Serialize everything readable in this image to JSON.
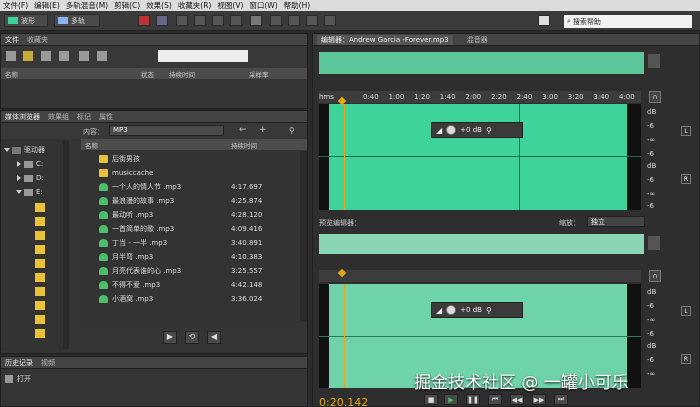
{
  "menu": [
    "文件(F)",
    "编辑(E)",
    "多轨混音(M)",
    "剪辑(C)",
    "效果(S)",
    "收藏夹(R)",
    "视图(V)",
    "窗口(W)",
    "帮助(H)"
  ],
  "toolbar": {
    "waveform_label": "波形",
    "multitrack_label": "多轨",
    "search_placeholder": "搜索帮助"
  },
  "files_panel": {
    "tabs": [
      "文件",
      "收藏夹"
    ],
    "columns": [
      "名称",
      "状态",
      "持续时间",
      "采样率"
    ]
  },
  "media_browser": {
    "tabs": [
      "媒体浏览器",
      "效果组",
      "标记",
      "属性"
    ],
    "content_label": "内容：",
    "content_value": "MP3",
    "drive_items": [
      "驱动器",
      "C:",
      "D:",
      "E:"
    ],
    "columns": [
      "名称",
      "持续时间"
    ],
    "rows": [
      {
        "name": "后街男孩",
        "duration": "",
        "type": "folder"
      },
      {
        "name": "musiccache",
        "duration": "",
        "type": "folder"
      },
      {
        "name": "一个人的情人节 .mp3",
        "duration": "4:17.697",
        "type": "mp3"
      },
      {
        "name": "最浪漫的故事 .mp3",
        "duration": "4:25.874",
        "type": "mp3"
      },
      {
        "name": "最动听 .mp3",
        "duration": "4:28.120",
        "type": "mp3"
      },
      {
        "name": "一首简单的歌 .mp3",
        "duration": "4:09.416",
        "type": "mp3"
      },
      {
        "name": "丁当 - 一半 .mp3",
        "duration": "3:40.891",
        "type": "mp3"
      },
      {
        "name": "月半弯 .mp3",
        "duration": "4:10.383",
        "type": "mp3"
      },
      {
        "name": "月亮代表谁的心 .mp3",
        "duration": "3:25.557",
        "type": "mp3"
      },
      {
        "name": "不得不爱 .mp3",
        "duration": "4:42.148",
        "type": "mp3"
      },
      {
        "name": "小酒窝 .mp3",
        "duration": "3:36.024",
        "type": "mp3"
      }
    ]
  },
  "history": {
    "tabs": [
      "历史记录",
      "视频"
    ],
    "item": "打开"
  },
  "editor": {
    "tab_label": "编辑器：Andrew Garcia -Forever.mp3",
    "mixer_label": "混音器",
    "ruler_unit": "hms",
    "ruler_ticks": [
      "0:40",
      "1:00",
      "1:20",
      "1:40",
      "2:00",
      "2:20",
      "2:40",
      "3:00",
      "3:20",
      "3:40",
      "4:00"
    ],
    "volume_value": "+0 dB",
    "db_labels": [
      "dB",
      "-6",
      "-∞",
      "-6",
      "dB",
      "-6",
      "-∞",
      "-6"
    ],
    "channels": [
      "L",
      "R"
    ]
  },
  "preview": {
    "label": "预览编辑器：",
    "zoom_label": "缩放：",
    "zoom_value": "独立",
    "volume_value": "+0 dB"
  },
  "timecode": "0:20.142",
  "watermark": "掘金技术社区 @ 一罐小可乐",
  "colors": {
    "wave": "#3ed39a",
    "wave_preview": "#6fd3a9",
    "folder": "#e9c23a",
    "playhead": "#e6a817"
  }
}
